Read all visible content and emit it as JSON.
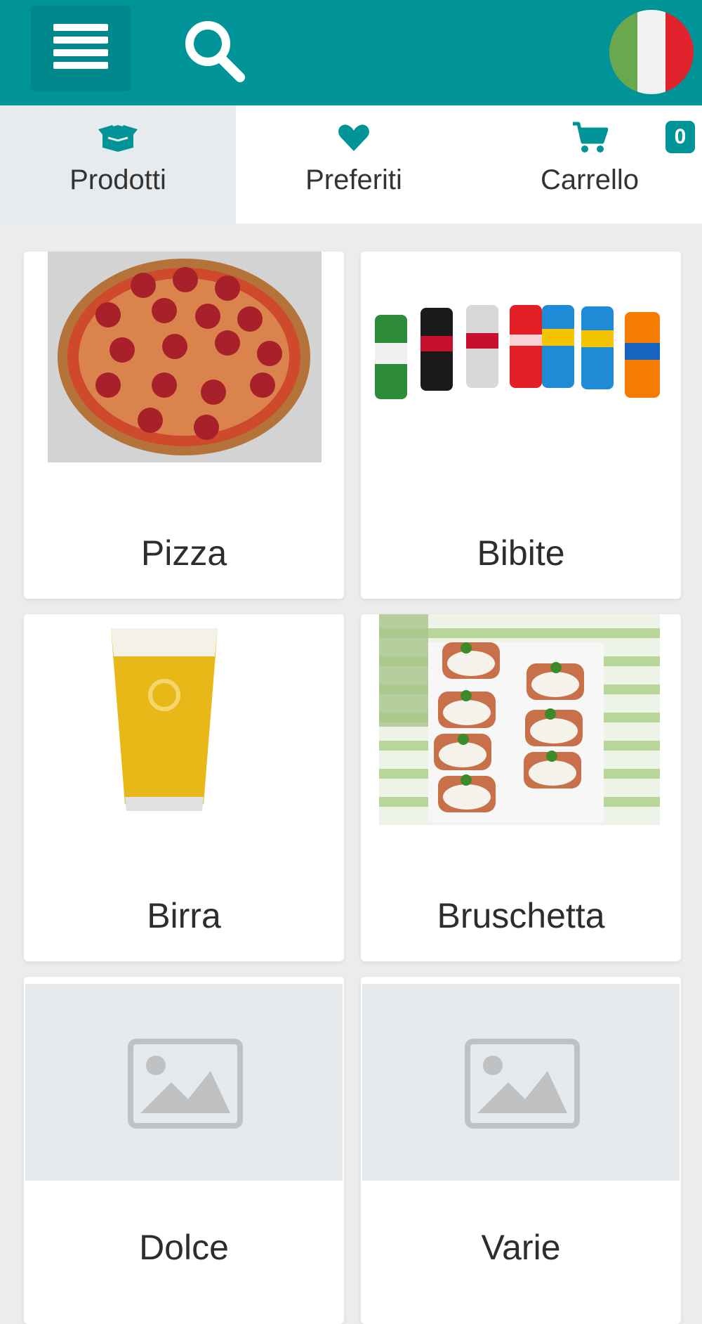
{
  "header": {
    "menu_icon": "hamburger-menu-icon",
    "search_icon": "search-icon",
    "language_flag": "italian-flag-icon",
    "flag_colors": [
      "#6aa84f",
      "#f2f2f2",
      "#e0232c"
    ],
    "brand_color": "#009499"
  },
  "tabs": [
    {
      "label": "Prodotti",
      "icon": "box-icon",
      "active": true
    },
    {
      "label": "Preferiti",
      "icon": "heart-icon",
      "active": false
    },
    {
      "label": "Carrello",
      "icon": "cart-icon",
      "active": false
    }
  ],
  "cart": {
    "count": "0"
  },
  "categories": [
    {
      "name": "Pizza",
      "image": "pizza-image"
    },
    {
      "name": "Bibite",
      "image": "soda-cans-image"
    },
    {
      "name": "Birra",
      "image": "beer-glass-image"
    },
    {
      "name": "Bruschetta",
      "image": "bruschetta-image"
    },
    {
      "name": "Dolce",
      "image": "placeholder-image"
    },
    {
      "name": "Varie",
      "image": "placeholder-image"
    }
  ]
}
